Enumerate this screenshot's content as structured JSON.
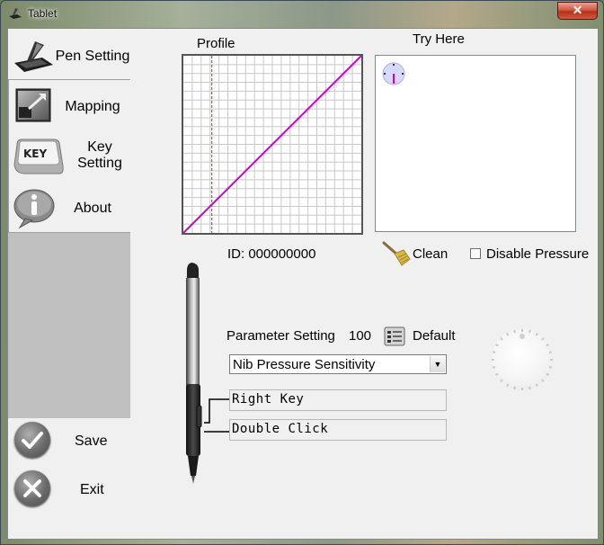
{
  "window": {
    "title": "Tablet",
    "close_label": "✕"
  },
  "sidebar": {
    "items": [
      {
        "label": "Pen Setting",
        "icon": "pen-tablet-icon"
      },
      {
        "label": "Mapping",
        "icon": "mapping-icon"
      },
      {
        "label": "Key\nSetting",
        "icon": "key-icon",
        "icon_text": "KEY"
      },
      {
        "label": "About",
        "icon": "info-icon",
        "icon_text": "i"
      }
    ],
    "save_label": "Save",
    "exit_label": "Exit"
  },
  "profile": {
    "heading": "Profile",
    "chart_data": {
      "type": "line",
      "title": "Profile",
      "xlim": [
        0,
        1
      ],
      "ylim": [
        0,
        1
      ],
      "x": [
        0,
        1
      ],
      "series": [
        {
          "values": [
            0,
            1
          ],
          "color": "#cc00cc"
        }
      ],
      "marker_x": 0.16,
      "grid": true
    }
  },
  "try_here": {
    "heading": "Try Here"
  },
  "device": {
    "id_label": "ID: 000000000"
  },
  "actions": {
    "clean_label": "Clean",
    "disable_pressure_label": "Disable Pressure",
    "disable_pressure_checked": false
  },
  "parameter": {
    "label": "Parameter Setting",
    "value": "100",
    "default_label": "Default",
    "selected_option": "Nib Pressure Sensitivity"
  },
  "pen_buttons": {
    "upper": "Right Key",
    "lower": "Double Click"
  },
  "colors": {
    "curve": "#cc00cc",
    "marker": "#cc2222",
    "grid": "#c8c8c8",
    "close_button": "#c8442e"
  }
}
